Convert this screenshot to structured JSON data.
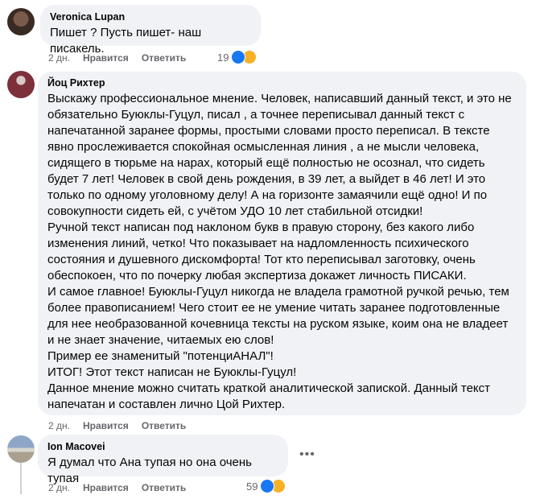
{
  "comments": [
    {
      "author": "Veronica Lupan",
      "text": "Пишет ? Пусть пишет- наш писакель.",
      "time": "2 дн.",
      "like": "Нравится",
      "reply": "Ответить",
      "reactions": "19"
    },
    {
      "author": "Йоц Рихтер",
      "text": "Выскажу профессиональное мнение. Человек, написавший данный текст, и это не обязательно Буюклы-Гуцул, писал , а точнее переписывал данный текст с напечатанной заранее формы, простыми словами просто переписал. В тексте явно прослеживается спокойная осмысленная линия , а не мысли человека, сидящего в тюрьме на нарах, который ещё полностью не осознал, что сидеть будет 7 лет! Человек в свой день рождения, в 39 лет, а выйдет в 46 лет! И это только по одному уголовному делу! А на горизонте замаячили ещё одно! И по совокупности сидеть ей, с учётом УДО 10 лет стабильной отсидки!\nРучной текст написан под наклоном букв в правую сторону, без какого либо изменения линий, четко! Что показывает на надломленность психического состояния и душевного дискомфорта! Тот кто переписывал заготовку, очень обеспокоен, что по почерку любая экспертиза докажет личность ПИСАКИ.\nИ самое главное! Буюклы-Гуцул никогда не владела грамотной ручкой речью, тем более правописанием! Чего стоит ее не умение читать заранее подготовленные для нее необразованной кочевница тексты на руском языке, коим она не владеет и не знает значение, читаемых ею слов!\nПример ее знаменитый \"потенциАНАЛ\"!\nИТОГ! Этот текст написан не Буюклы-Гуцул!\nДанное мнение можно считать краткой аналитической запиской. Данный текст напечатан и составлен лично Цой Рихтер.",
      "time": "2 дн.",
      "like": "Нравится",
      "reply": "Ответить"
    },
    {
      "author": "Ion Macovei",
      "text": "Я думал что Ана тупая но она очень тупая",
      "time": "2 дн.",
      "like": "Нравится",
      "reply": "Ответить",
      "reactions": "59"
    }
  ],
  "colors": {
    "bubble": "#f0f2f5",
    "meta": "#65676b",
    "like": "#1877f2",
    "haha": "#f7b125"
  }
}
